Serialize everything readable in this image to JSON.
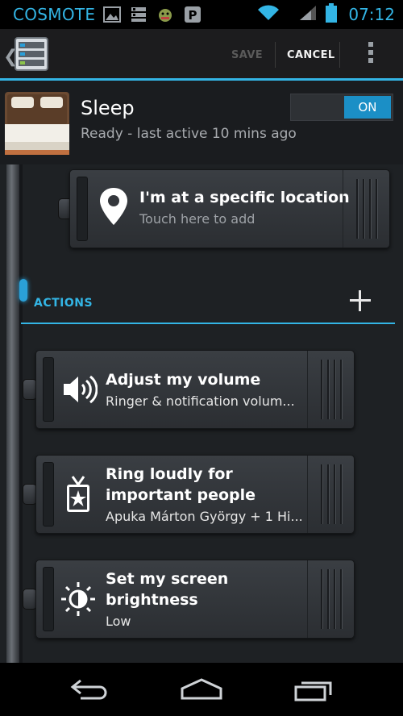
{
  "status_bar": {
    "carrier": "COSMOTE",
    "time": "07:12",
    "icons": [
      "image-icon",
      "list-icon",
      "android-icon",
      "pinterest-icon",
      "wifi-icon",
      "signal-icon",
      "battery-icon"
    ]
  },
  "action_bar": {
    "save_label": "SAVE",
    "cancel_label": "CANCEL",
    "icons": [
      "app-list-icon",
      "overflow-menu-icon"
    ]
  },
  "profile": {
    "name": "Sleep",
    "status": "Ready - last active 10 mins ago",
    "toggle_label": "ON",
    "icon": "bed-icon"
  },
  "condition": {
    "title": "I'm at a specific location",
    "subtitle": "Touch here to add",
    "icon": "location-pin-icon"
  },
  "actions_section": {
    "header": "ACTIONS",
    "add_icon": "plus-icon"
  },
  "actions": [
    {
      "title_line1": "Adjust my volume",
      "title_line2": "",
      "subtitle": "Ringer & notification volum...",
      "icon": "speaker-icon"
    },
    {
      "title_line1": "Ring loudly for",
      "title_line2": "important people",
      "subtitle": "Apuka Márton György + 1 Hi...",
      "icon": "vip-badge-icon"
    },
    {
      "title_line1": "Set my screen",
      "title_line2": "brightness",
      "subtitle": "Low",
      "icon": "brightness-icon"
    }
  ],
  "nav_bar": {
    "icons": [
      "back-icon",
      "home-icon",
      "recents-icon"
    ]
  },
  "colors": {
    "accent": "#33b5e5",
    "toggle_on": "#1b8fc6",
    "card": "#34373c",
    "background": "#1e2124"
  }
}
